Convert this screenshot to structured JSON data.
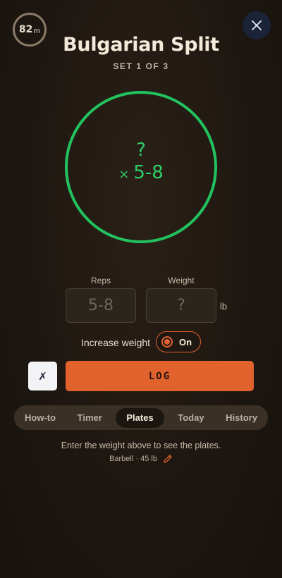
{
  "header": {
    "timer_value": "82",
    "timer_unit": "m",
    "title": "Bulgarian Split",
    "set_label": "SET 1 OF 3",
    "close_icon": "close-icon"
  },
  "target": {
    "weight": "?",
    "reps_prefix": "×",
    "reps": "5-8",
    "ring_color": "#22c35e"
  },
  "inputs": {
    "reps_label": "Reps",
    "reps_placeholder": "5-8",
    "weight_label": "Weight",
    "weight_placeholder": "?",
    "weight_unit": "lb"
  },
  "increase_weight": {
    "label": "Increase weight",
    "toggle_label": "On"
  },
  "actions": {
    "skip_label": "✗",
    "log_label": "LOG",
    "accent": "#e2622e"
  },
  "tabs": [
    {
      "label": "How-to"
    },
    {
      "label": "Timer"
    },
    {
      "label": "Plates",
      "active": true
    },
    {
      "label": "Today"
    },
    {
      "label": "History"
    }
  ],
  "plates": {
    "hint": "Enter the weight above to see the plates.",
    "barbell": "Barbell · 45 lb",
    "edit_icon": "pencil-icon"
  }
}
